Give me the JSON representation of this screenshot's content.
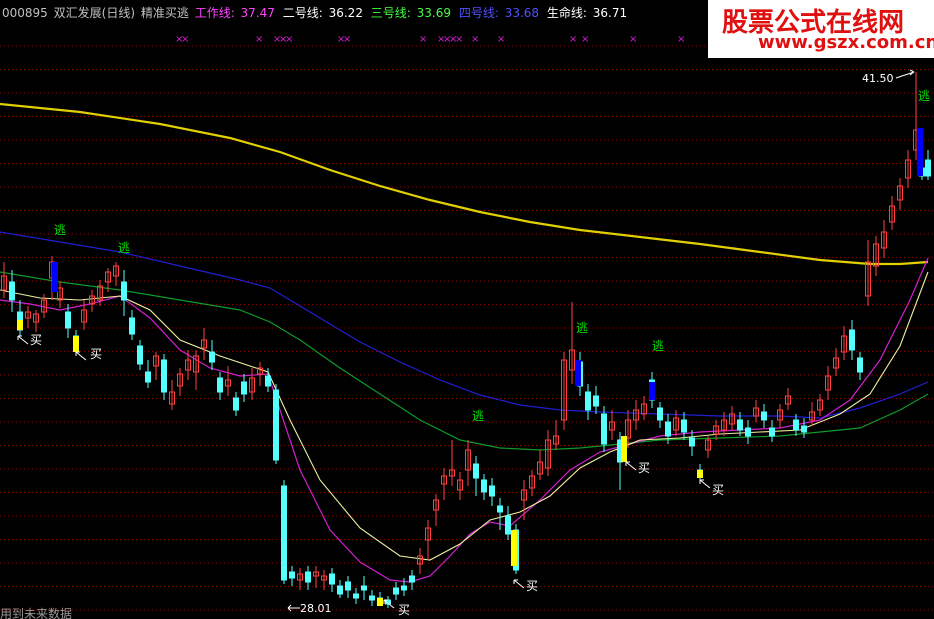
{
  "header": {
    "code": "000895",
    "name": "双汇发展(日线)",
    "indicator": "精准买逃",
    "lines": [
      {
        "label": "工作线: ",
        "value": "37.47",
        "color": "#ff44ff"
      },
      {
        "label": "二号线: ",
        "value": "36.22",
        "color": "#ffffff"
      },
      {
        "label": "三号线: ",
        "value": "33.69",
        "color": "#44ff44"
      },
      {
        "label": "四号线: ",
        "value": "33.68",
        "color": "#4444ff"
      },
      {
        "label": "生命线: ",
        "value": "36.71",
        "color": "#ffffff"
      }
    ]
  },
  "logo": {
    "title": "股票公式在线网",
    "url": "www.gszx.com.cn"
  },
  "footer": {
    "text": "用到未来数据"
  },
  "colors": {
    "up": "#ff4040",
    "down": "#54ffff",
    "buy_bar": "#ffff00",
    "sell_bar": "#0000ff",
    "gridline": "#8b0000",
    "long_ma": "#e0d000",
    "blue_line": "#2020d0",
    "green_line": "#0c9a2a",
    "magenta_line": "#d020d0",
    "ivory_line": "#f0f0a0",
    "signal_sell": "#00e000",
    "signal_buy": "#ffffff"
  },
  "chart_data": {
    "type": "candlestick",
    "y_range": [
      27.6,
      42.5
    ],
    "grid": true,
    "series_lines": [
      {
        "name": "生命线",
        "color": "#e0d000"
      },
      {
        "name": "四号线",
        "color": "#2020d0"
      },
      {
        "name": "三号线",
        "color": "#0c9a2a"
      },
      {
        "name": "工作线",
        "color": "#d020d0"
      },
      {
        "name": "二号线",
        "color": "#f0f0a0"
      }
    ],
    "annotations": {
      "max_label": "41.50",
      "min_label": "28.01"
    },
    "signals": {
      "buy": "买",
      "sell": "逃",
      "marks": "×"
    }
  }
}
